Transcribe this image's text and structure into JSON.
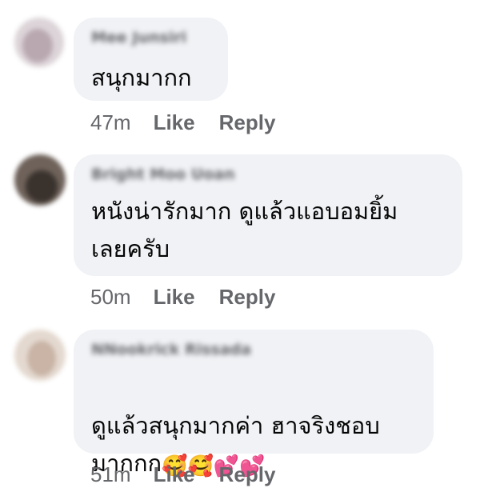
{
  "comments": [
    {
      "author": "Mee Junsiri",
      "text": "สนุกมากก",
      "time": "47m",
      "like_label": "Like",
      "reply_label": "Reply",
      "avatar_colors": [
        "#d9cfd4",
        "#b8a7b1"
      ]
    },
    {
      "author": "Bright Moo Uoan",
      "text": "หนังน่ารักมาก  ดูแล้วแอบอมยิ้ม\nเลยครับ",
      "time": "50m",
      "like_label": "Like",
      "reply_label": "Reply",
      "avatar_colors": [
        "#8a7a70",
        "#3d3530"
      ]
    },
    {
      "author": "NNookrick Rissada",
      "text": "ดูแล้วสนุกมากค่า ฮาจริงชอบ\nมากกก",
      "emojis": "🥰🥰💕💕",
      "time": "51m",
      "like_label": "Like",
      "reply_label": "Reply",
      "avatar_colors": [
        "#e3d6cc",
        "#c6b1a3"
      ]
    }
  ]
}
